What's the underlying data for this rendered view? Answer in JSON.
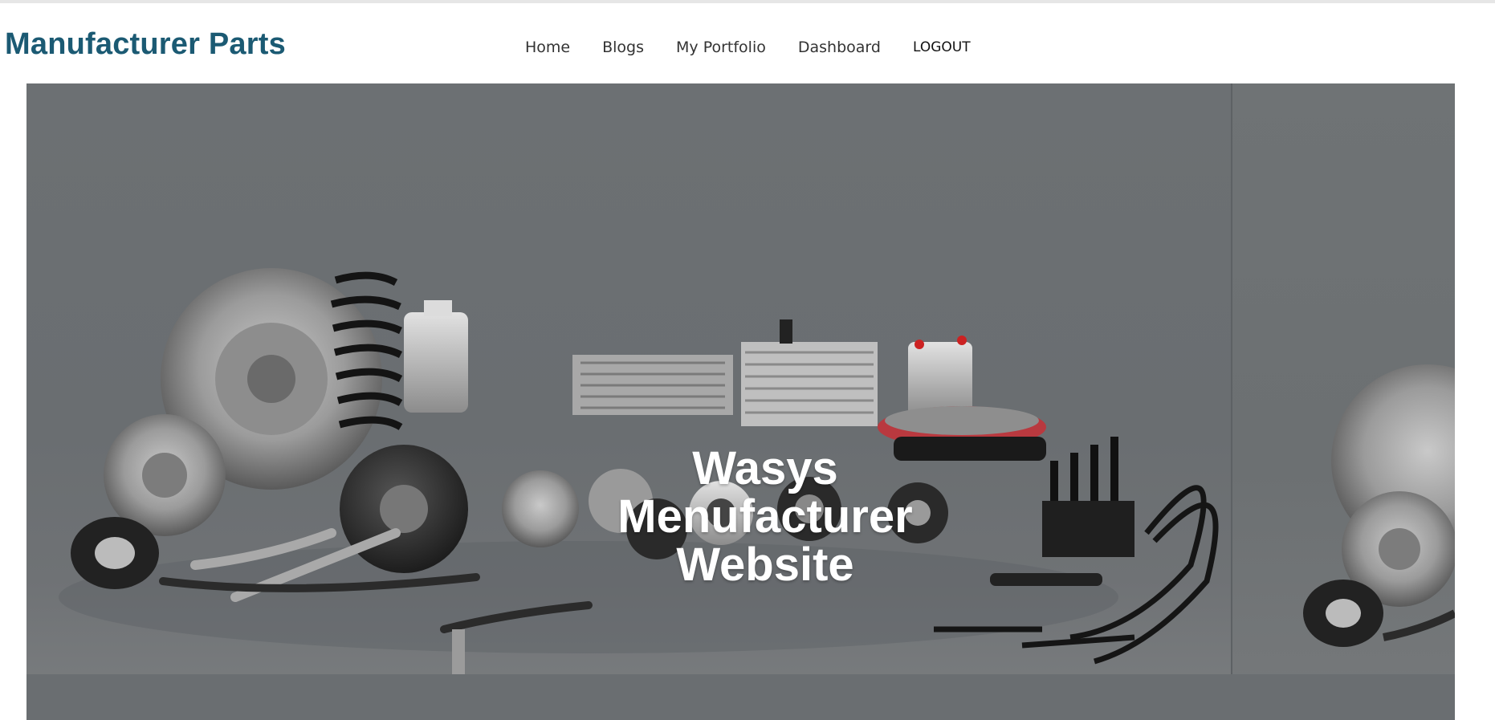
{
  "brand": {
    "name": "Manufacturer Parts"
  },
  "nav": {
    "items": [
      {
        "label": "Home"
      },
      {
        "label": "Blogs"
      },
      {
        "label": "My Portfolio"
      },
      {
        "label": "Dashboard"
      }
    ],
    "logout_label": "LOGOUT"
  },
  "hero": {
    "title_lines": [
      "Wasys",
      "Menufacturer",
      "Website"
    ],
    "image": "auto-parts-collection-photo"
  },
  "colors": {
    "brand": "#1b5a73",
    "hero_bg": "#6c7073",
    "hero_text": "#ffffff"
  }
}
